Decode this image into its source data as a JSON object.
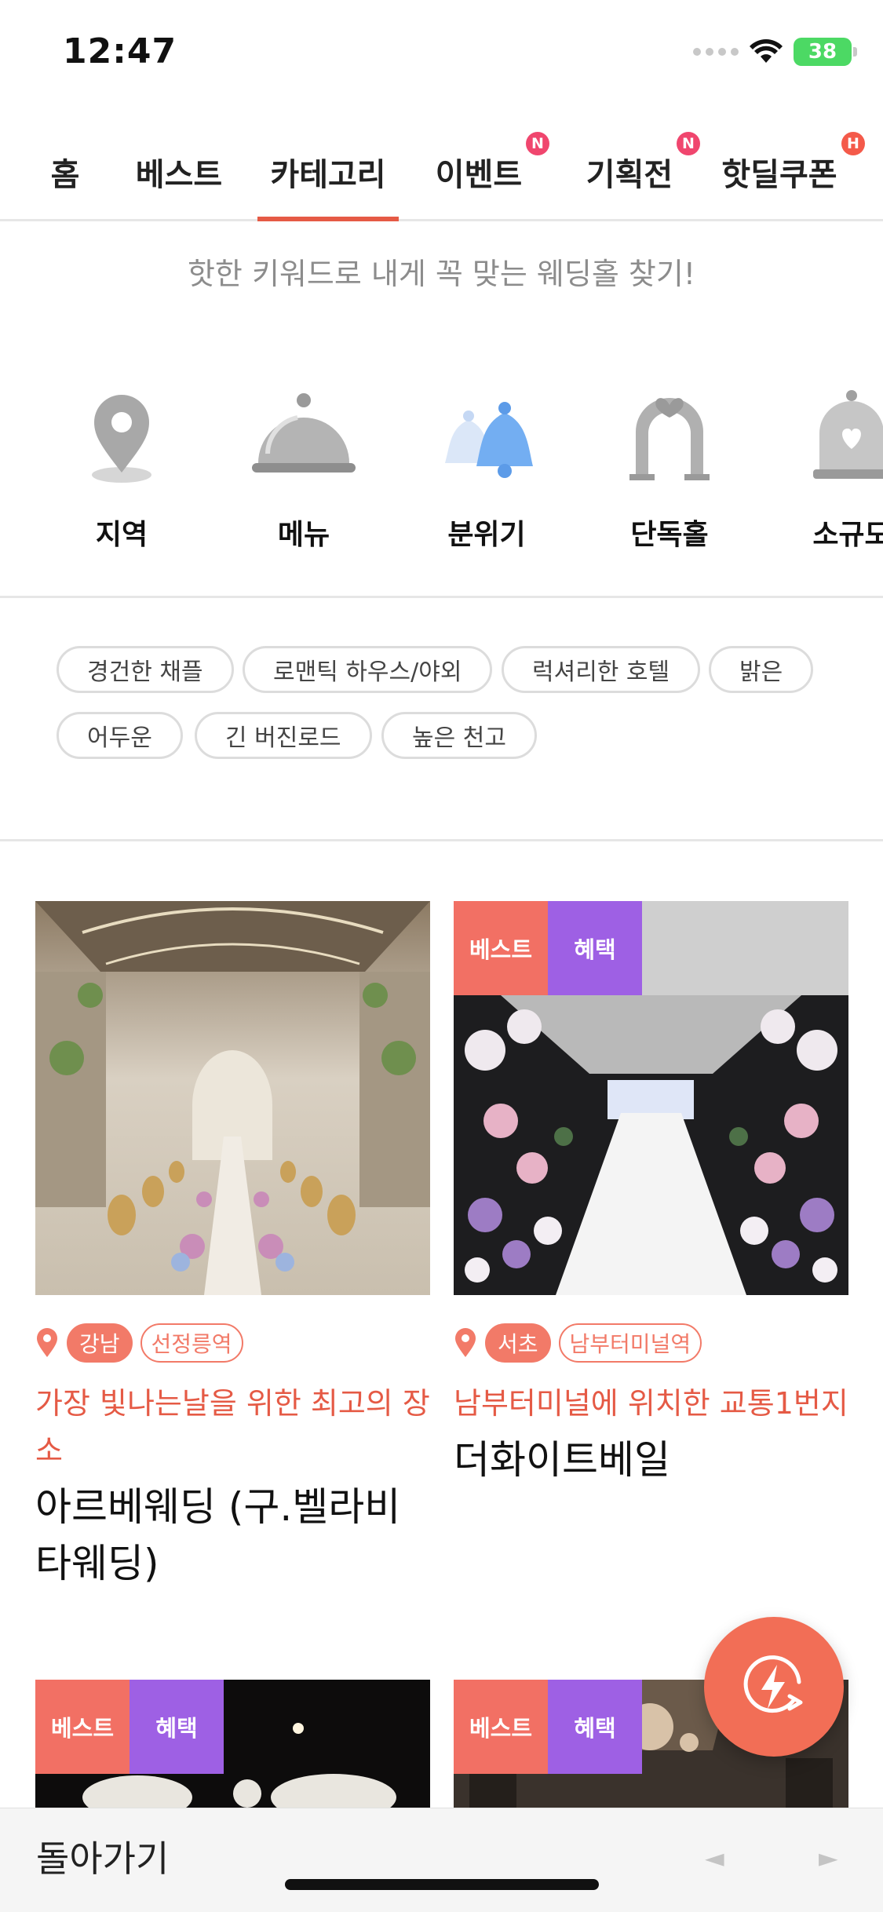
{
  "status_bar": {
    "time": "12:47",
    "battery": "38"
  },
  "tabs": [
    {
      "label": "홈",
      "badge": ""
    },
    {
      "label": "베스트",
      "badge": ""
    },
    {
      "label": "카테고리",
      "badge": ""
    },
    {
      "label": "이벤트",
      "badge": "N"
    },
    {
      "label": "기획전",
      "badge": "N"
    },
    {
      "label": "핫딜쿠폰",
      "badge": "H"
    }
  ],
  "active_tab": "카테고리",
  "subtitle": "핫한 키워드로 내게 꼭 맞는 웨딩홀 찾기!",
  "categories": [
    {
      "label": "지역",
      "icon": "location-pin-icon"
    },
    {
      "label": "메뉴",
      "icon": "food-cloche-icon"
    },
    {
      "label": "분위기",
      "icon": "bells-icon"
    },
    {
      "label": "단독홀",
      "icon": "wedding-arch-icon"
    },
    {
      "label": "소규모",
      "icon": "heart-dome-icon"
    }
  ],
  "keywords": [
    "경건한 채플",
    "로맨틱 하우스/야외",
    "럭셔리한 호텔",
    "밝은",
    "어두운",
    "긴 버진로드",
    "높은 천고"
  ],
  "venues": [
    {
      "tags": [],
      "area": "강남",
      "station": "선정릉역",
      "description": "가장 빛나는날을 위한 최고의 장소",
      "name": "아르베웨딩 (구.벨라비타웨딩)"
    },
    {
      "tags": [
        "베스트",
        "혜택"
      ],
      "area": "서초",
      "station": "남부터미널역",
      "description": "남부터미널에 위치한 교통1번지",
      "name": "더화이트베일"
    },
    {
      "tags": [
        "베스트",
        "혜택"
      ]
    },
    {
      "tags": [
        "베스트",
        "혜택"
      ]
    }
  ],
  "bottom_bar": {
    "back_label": "돌아가기",
    "prev": "◄",
    "next": "►"
  },
  "colors": {
    "accent": "#e55a45",
    "best_tag": "#f27064",
    "benefit_tag": "#9e60e4"
  }
}
